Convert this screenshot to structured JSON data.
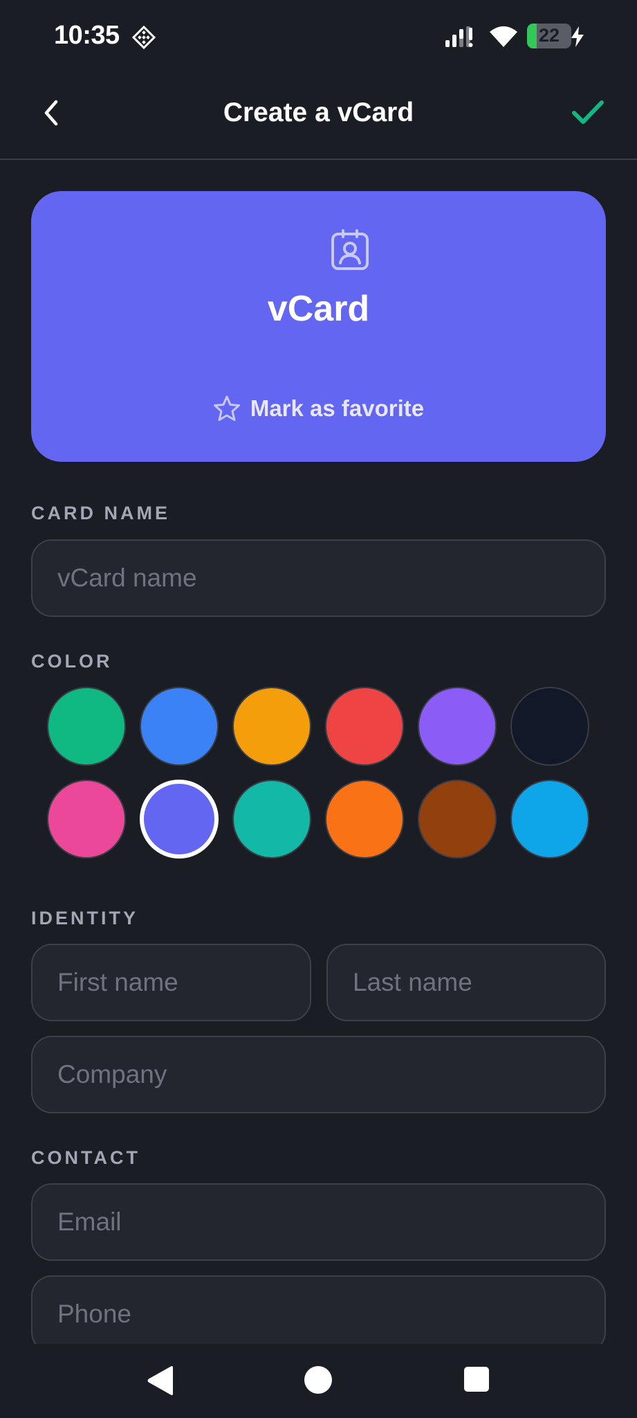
{
  "status_bar": {
    "time": "10:35",
    "battery_level": "22",
    "battery_fraction": 0.22,
    "icons": [
      "diamond-grid-icon",
      "cell-signal-icon",
      "wifi-icon",
      "battery-icon",
      "charging-bolt-icon"
    ]
  },
  "app_bar": {
    "title": "Create a vCard",
    "back_icon": "chevron-left-icon",
    "confirm_icon": "checkmark-icon",
    "confirm_color": "#10b981"
  },
  "preview": {
    "title": "vCard",
    "icon": "contact-badge-icon",
    "favorite_label": "Mark as favorite",
    "favorite_icon": "star-outline-icon",
    "background": "#6366f1"
  },
  "card_name": {
    "section_label": "CARD NAME",
    "placeholder": "vCard name",
    "value": ""
  },
  "color": {
    "section_label": "COLOR",
    "selected_index": 7,
    "options": [
      {
        "name": "green",
        "hex": "#10b981"
      },
      {
        "name": "blue",
        "hex": "#3b82f6"
      },
      {
        "name": "amber",
        "hex": "#f59e0b"
      },
      {
        "name": "red",
        "hex": "#ef4444"
      },
      {
        "name": "violet",
        "hex": "#8b5cf6"
      },
      {
        "name": "navy",
        "hex": "#111827"
      },
      {
        "name": "pink",
        "hex": "#ec4899"
      },
      {
        "name": "indigo",
        "hex": "#6366f1"
      },
      {
        "name": "teal",
        "hex": "#14b8a6"
      },
      {
        "name": "orange",
        "hex": "#f97316"
      },
      {
        "name": "brown",
        "hex": "#92400e"
      },
      {
        "name": "sky",
        "hex": "#0ea5e9"
      }
    ]
  },
  "identity": {
    "section_label": "IDENTITY",
    "first_name_placeholder": "First name",
    "last_name_placeholder": "Last name",
    "company_placeholder": "Company"
  },
  "contact": {
    "section_label": "CONTACT",
    "email_placeholder": "Email",
    "phone_placeholder": "Phone"
  },
  "nav_bar": {
    "icons": [
      "nav-back-icon",
      "nav-home-icon",
      "nav-recents-icon"
    ]
  }
}
